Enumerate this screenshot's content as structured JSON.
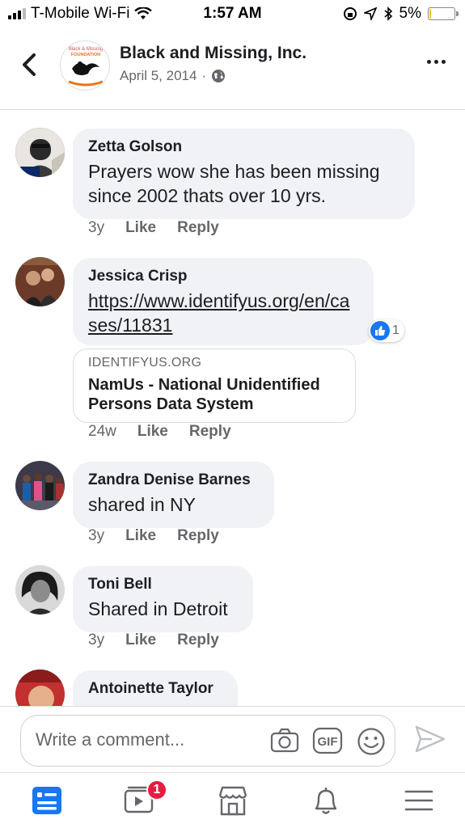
{
  "status_bar": {
    "carrier": "T-Mobile Wi-Fi",
    "time": "1:57 AM",
    "battery": "5%",
    "battery_level": 0.05,
    "battery_color": "#f5c518"
  },
  "header": {
    "page_name": "Black and Missing, Inc.",
    "date": "April 5, 2014",
    "separator": "·",
    "privacy_icon": "globe-icon",
    "avatar_text_top": "Black & Missing",
    "avatar_text_mid": "FOUNDATION"
  },
  "comments": [
    {
      "name": "Zetta Golson",
      "text": "Prayers wow she has been missing since 2002 thats over 10 yrs.",
      "time": "3y",
      "like": "Like",
      "reply": "Reply"
    },
    {
      "name": "Jessica Crisp",
      "link": "https://www.identifyus.org/en/cases/11831",
      "reaction_count": "1",
      "time": "24w",
      "like": "Like",
      "reply": "Reply",
      "card": {
        "domain": "IDENTIFYUS.ORG",
        "title": "NamUs - National Unidentified Persons Data System"
      }
    },
    {
      "name": "Zandra Denise Barnes",
      "text": "shared in NY",
      "time": "3y",
      "like": "Like",
      "reply": "Reply"
    },
    {
      "name": "Toni Bell",
      "text": "Shared in Detroit",
      "time": "3y",
      "like": "Like",
      "reply": "Reply"
    },
    {
      "name": "Antoinette Taylor"
    }
  ],
  "composer": {
    "placeholder": "Write a comment..."
  },
  "bottom_nav": {
    "items": [
      "news-feed-icon",
      "watch-icon",
      "marketplace-icon",
      "notifications-icon",
      "menu-icon"
    ],
    "watch_badge": "1",
    "active_color": "#1877f2"
  }
}
